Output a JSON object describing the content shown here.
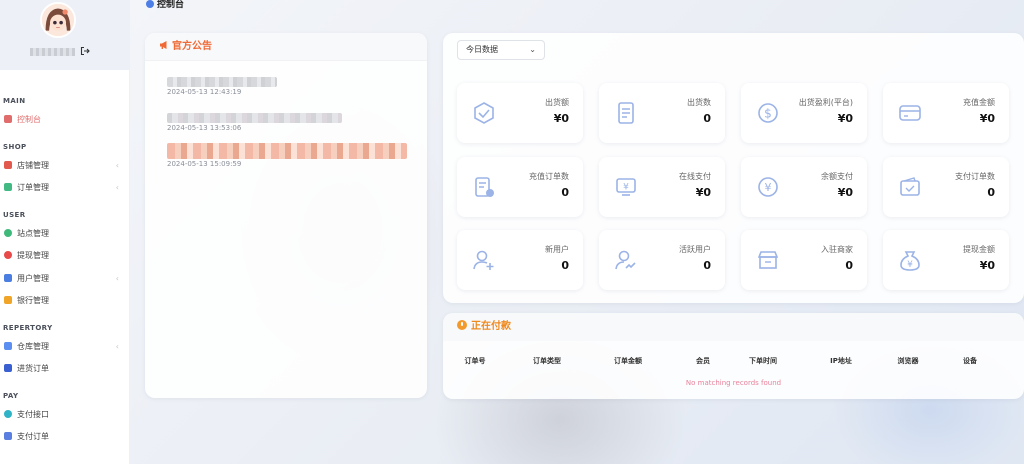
{
  "topbar": {
    "title": "控制台"
  },
  "sidebar": {
    "username": "",
    "sections": [
      {
        "label": "MAIN",
        "items": [
          {
            "label": "控制台",
            "icon": "home-icon",
            "color": "#e06c6c",
            "active": true,
            "expandable": false
          }
        ]
      },
      {
        "label": "SHOP",
        "items": [
          {
            "label": "店铺管理",
            "icon": "shop-icon",
            "color": "#e25a4d",
            "active": false,
            "expandable": true
          },
          {
            "label": "订单管理",
            "icon": "order-icon",
            "color": "#42b883",
            "active": false,
            "expandable": true
          }
        ]
      },
      {
        "label": "USER",
        "items": [
          {
            "label": "站点管理",
            "icon": "site-icon",
            "color": "#3fb97a",
            "active": false,
            "expandable": false
          },
          {
            "label": "提现管理",
            "icon": "withdraw-icon",
            "color": "#e84a4a",
            "active": false,
            "expandable": false
          },
          {
            "label": "用户管理",
            "icon": "user-icon",
            "color": "#4a7ee0",
            "active": false,
            "expandable": true
          },
          {
            "label": "银行管理",
            "icon": "bank-icon",
            "color": "#f0a528",
            "active": false,
            "expandable": false
          }
        ]
      },
      {
        "label": "REPERTORY",
        "items": [
          {
            "label": "仓库管理",
            "icon": "warehouse-icon",
            "color": "#5a8ef0",
            "active": false,
            "expandable": true
          },
          {
            "label": "进货订单",
            "icon": "purchase-icon",
            "color": "#3a5fd0",
            "active": false,
            "expandable": false
          }
        ]
      },
      {
        "label": "PAY",
        "items": [
          {
            "label": "支付接口",
            "icon": "payment-interface-icon",
            "color": "#2fb3c6",
            "active": false,
            "expandable": false
          },
          {
            "label": "支付订单",
            "icon": "payment-order-icon",
            "color": "#5a7fe0",
            "active": false,
            "expandable": false
          }
        ]
      }
    ]
  },
  "notice": {
    "title": "官方公告",
    "items": [
      {
        "title": "",
        "date": "2024-05-13 12:43:19"
      },
      {
        "title": "",
        "date": "2024-05-13 13:53:06"
      },
      {
        "title": "",
        "date": "2024-05-13 15:09:59"
      }
    ]
  },
  "stats": {
    "range_select": "今日数据",
    "cards": [
      {
        "label": "出货额",
        "value": "¥0",
        "icon": "box-icon"
      },
      {
        "label": "出货数",
        "value": "0",
        "icon": "document-icon"
      },
      {
        "label": "出货盈利(平台)",
        "value": "¥0",
        "icon": "profit-icon"
      },
      {
        "label": "充值金额",
        "value": "¥0",
        "icon": "card-icon"
      },
      {
        "label": "充值订单数",
        "value": "0",
        "icon": "recharge-order-icon"
      },
      {
        "label": "在线支付",
        "value": "¥0",
        "icon": "online-pay-icon"
      },
      {
        "label": "余额支付",
        "value": "¥0",
        "icon": "balance-pay-icon"
      },
      {
        "label": "支付订单数",
        "value": "0",
        "icon": "wallet-check-icon"
      },
      {
        "label": "新用户",
        "value": "0",
        "icon": "new-user-icon"
      },
      {
        "label": "活跃用户",
        "value": "0",
        "icon": "active-user-icon"
      },
      {
        "label": "入驻商家",
        "value": "0",
        "icon": "merchant-icon"
      },
      {
        "label": "提现金额",
        "value": "¥0",
        "icon": "money-bag-icon"
      }
    ]
  },
  "paying": {
    "title": "正在付款",
    "columns": [
      "订单号",
      "订单类型",
      "订单金额",
      "会员",
      "下单时间",
      "IP地址",
      "浏览器",
      "设备"
    ],
    "empty_text": "No matching records found"
  }
}
